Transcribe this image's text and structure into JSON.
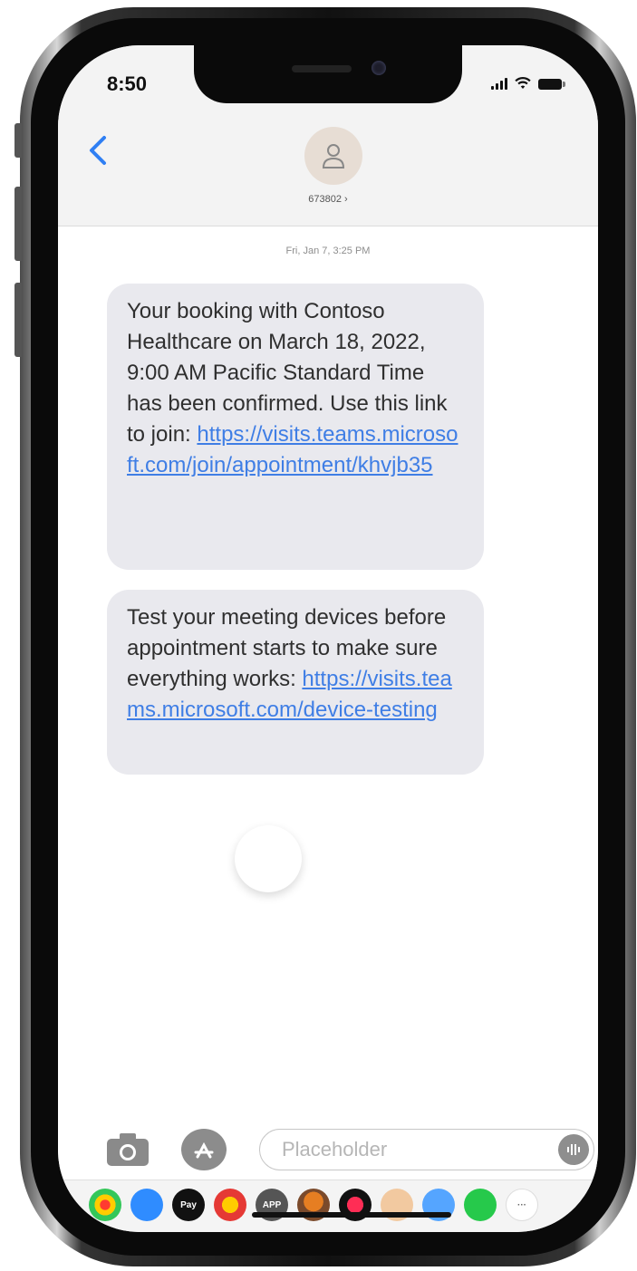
{
  "status_bar": {
    "time": "8:50"
  },
  "header": {
    "contact_name": "673802 ›"
  },
  "conversation": {
    "timestamp": "Fri, Jan 7, 3:25 PM",
    "message1": {
      "text": "Your booking with Contoso Healthcare on March 18, 2022, 9:00 AM Pacific Standard Time has been confirmed. Use this link to join: ",
      "link": "https://visits.teams.microsoft.com/join/appointment/khvjb35"
    },
    "message2": {
      "text": "Test your meeting devices before appointment starts to make sure everything works: ",
      "link": "https://visits.teams.microsoft.com/device-testing"
    }
  },
  "compose": {
    "placeholder": "Placeholder"
  },
  "app_drawer": {
    "icons": [
      {
        "name": "photos-app-icon",
        "label": ""
      },
      {
        "name": "app-store-icon",
        "label": ""
      },
      {
        "name": "apple-pay-icon",
        "label": "Pay"
      },
      {
        "name": "digital-touch-icon",
        "label": ""
      },
      {
        "name": "app-icon",
        "label": "APP"
      },
      {
        "name": "memoji-icon",
        "label": ""
      },
      {
        "name": "digital-touch-heart-icon",
        "label": ""
      },
      {
        "name": "cookie-icon",
        "label": ""
      },
      {
        "name": "app-store-icon-2",
        "label": ""
      },
      {
        "name": "message-app-icon",
        "label": ""
      },
      {
        "name": "more-apps-icon",
        "label": "···"
      }
    ]
  },
  "colors": {
    "link": "#3f7ee5",
    "bubble": "#e9e9ee",
    "header_bg": "#f3f3f3",
    "back_chevron": "#2f7ff3"
  }
}
